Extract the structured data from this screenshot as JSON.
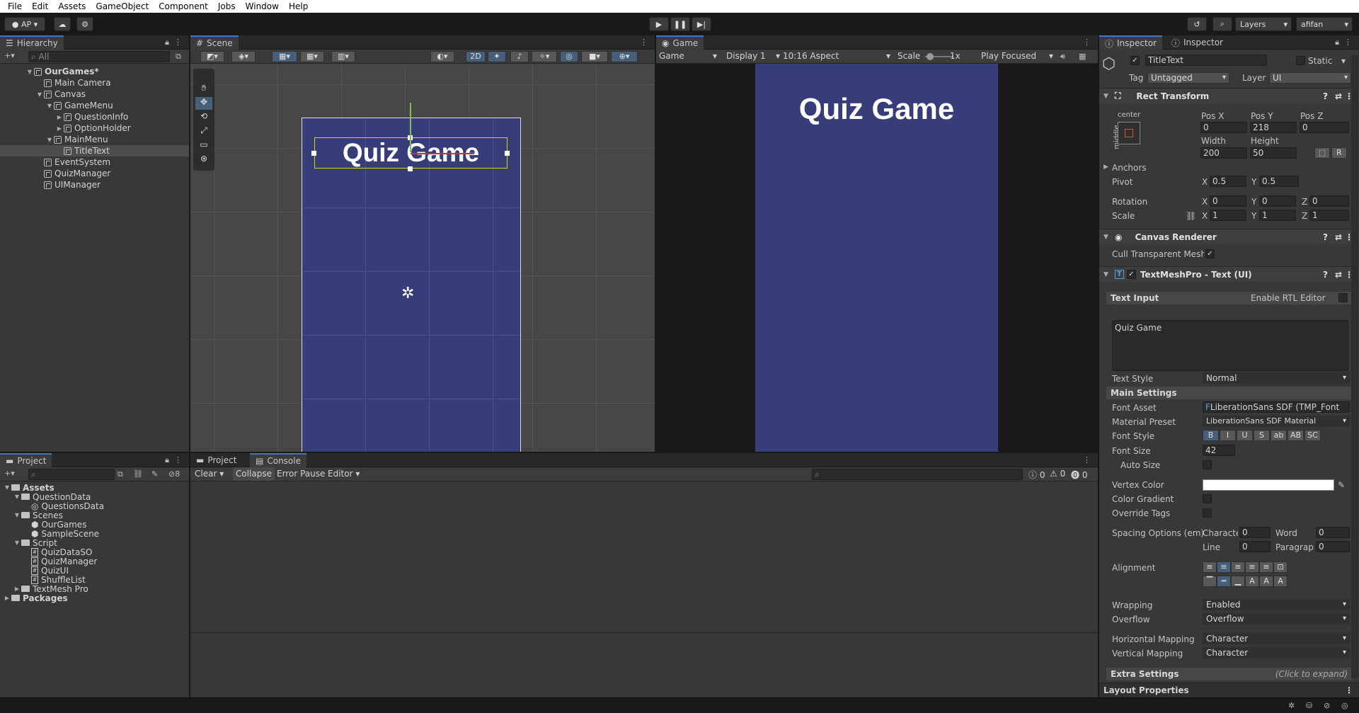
{
  "menubar": [
    "File",
    "Edit",
    "Assets",
    "GameObject",
    "Component",
    "Jobs",
    "Window",
    "Help"
  ],
  "toolbar": {
    "account": "AP",
    "layers": "Layers",
    "user": "afifan"
  },
  "hierarchy": {
    "tab": "Hierarchy",
    "search_placeholder": "All",
    "rows": [
      {
        "label": "OurGames*",
        "depth": 0,
        "icon": "scene-icon",
        "arrow": "▼"
      },
      {
        "label": "Main Camera",
        "depth": 1,
        "icon": "cube-icon",
        "arrow": ""
      },
      {
        "label": "Canvas",
        "depth": 1,
        "icon": "cube-icon",
        "arrow": "▼"
      },
      {
        "label": "GameMenu",
        "depth": 2,
        "icon": "cube-icon",
        "arrow": "▼"
      },
      {
        "label": "QuestionInfo",
        "depth": 3,
        "icon": "cube-icon",
        "arrow": "▶"
      },
      {
        "label": "OptionHolder",
        "depth": 3,
        "icon": "cube-icon",
        "arrow": "▶"
      },
      {
        "label": "MainMenu",
        "depth": 2,
        "icon": "cube-icon",
        "arrow": "▼"
      },
      {
        "label": "TitleText",
        "depth": 3,
        "icon": "cube-icon",
        "arrow": "",
        "selected": true
      },
      {
        "label": "EventSystem",
        "depth": 1,
        "icon": "cube-icon",
        "arrow": ""
      },
      {
        "label": "QuizManager",
        "depth": 1,
        "icon": "cube-icon",
        "arrow": ""
      },
      {
        "label": "UIManager",
        "depth": 1,
        "icon": "cube-icon",
        "arrow": ""
      }
    ]
  },
  "scene": {
    "tab": "Scene",
    "mode2d": "2D",
    "title_text": "Quiz Game"
  },
  "game": {
    "tab": "Game",
    "display_mode": "Game",
    "display": "Display 1",
    "aspect": "10:16 Aspect",
    "scale_label": "Scale",
    "scale_value": "1x",
    "play_mode": "Play Focused",
    "title_text": "Quiz Game"
  },
  "project": {
    "tab": "Project",
    "hidden_count": "8",
    "rows": [
      {
        "label": "Assets",
        "depth": 0,
        "type": "folder",
        "arrow": "▼",
        "bold": true
      },
      {
        "label": "QuestionData",
        "depth": 1,
        "type": "folder",
        "arrow": "▼"
      },
      {
        "label": "QuestionsData",
        "depth": 2,
        "type": "asset",
        "arrow": ""
      },
      {
        "label": "Scenes",
        "depth": 1,
        "type": "folder",
        "arrow": "▼"
      },
      {
        "label": "OurGames",
        "depth": 2,
        "type": "scene",
        "arrow": ""
      },
      {
        "label": "SampleScene",
        "depth": 2,
        "type": "scene",
        "arrow": ""
      },
      {
        "label": "Script",
        "depth": 1,
        "type": "folder",
        "arrow": "▼"
      },
      {
        "label": "QuizDataSO",
        "depth": 2,
        "type": "script",
        "arrow": ""
      },
      {
        "label": "QuizManager",
        "depth": 2,
        "type": "script",
        "arrow": ""
      },
      {
        "label": "QuizUI",
        "depth": 2,
        "type": "script",
        "arrow": ""
      },
      {
        "label": "ShuffleList",
        "depth": 2,
        "type": "script",
        "arrow": ""
      },
      {
        "label": "TextMesh Pro",
        "depth": 1,
        "type": "folder",
        "arrow": "▶"
      },
      {
        "label": "Packages",
        "depth": 0,
        "type": "folder",
        "arrow": "▶",
        "bold": true
      }
    ]
  },
  "console": {
    "tab_project": "Project",
    "tab_console": "Console",
    "clear": "Clear",
    "collapse": "Collapse",
    "error_pause": "Error Pause",
    "editor": "Editor",
    "count_log": "0",
    "count_warn": "0",
    "count_err": "0"
  },
  "inspector": {
    "tab1": "Inspector",
    "tab2": "Inspector",
    "object_name": "TitleText",
    "static_label": "Static",
    "tag_label": "Tag",
    "tag_value": "Untagged",
    "layer_label": "Layer",
    "layer_value": "UI",
    "rect": {
      "title": "Rect Transform",
      "anchor_h": "center",
      "anchor_v": "middle",
      "posx_label": "Pos X",
      "posy_label": "Pos Y",
      "posz_label": "Pos Z",
      "posx": "0",
      "posy": "218",
      "posz": "0",
      "width_label": "Width",
      "height_label": "Height",
      "width": "200",
      "height": "50",
      "anchors": "Anchors",
      "pivot": "Pivot",
      "pivot_x": "0.5",
      "pivot_y": "0.5",
      "rotation": "Rotation",
      "rot_x": "0",
      "rot_y": "0",
      "rot_z": "0",
      "scale": "Scale",
      "scale_x": "1",
      "scale_y": "1",
      "scale_z": "1",
      "r_button": "R"
    },
    "canvas_renderer": {
      "title": "Canvas Renderer",
      "cull_label": "Cull Transparent Mesh"
    },
    "tmp": {
      "title": "TextMeshPro - Text (UI)",
      "text_input": "Text Input",
      "rtl": "Enable RTL Editor",
      "text": "Quiz Game",
      "text_style_label": "Text Style",
      "text_style": "Normal",
      "main_settings": "Main Settings",
      "font_asset_label": "Font Asset",
      "font_asset": "LiberationSans SDF (TMP_Font",
      "material_label": "Material Preset",
      "material": "LiberationSans SDF Material",
      "font_style_label": "Font Style",
      "font_styles": [
        "B",
        "I",
        "U",
        "S",
        "ab",
        "AB",
        "SC"
      ],
      "font_size_label": "Font Size",
      "font_size": "42",
      "auto_size": "Auto Size",
      "vertex_color": "Vertex Color",
      "color_gradient": "Color Gradient",
      "override_tags": "Override Tags",
      "spacing_label": "Spacing Options (em)",
      "char_label": "Character",
      "char_val": "0",
      "word_label": "Word",
      "word_val": "0",
      "line_label": "Line",
      "line_val": "0",
      "para_label": "Paragraph",
      "para_val": "0",
      "alignment": "Alignment",
      "wrapping_label": "Wrapping",
      "wrapping": "Enabled",
      "overflow_label": "Overflow",
      "overflow": "Overflow",
      "hmap_label": "Horizontal Mapping",
      "hmap": "Character",
      "vmap_label": "Vertical Mapping",
      "vmap": "Character",
      "extra": "Extra Settings",
      "extra_hint": "(Click to expand)"
    },
    "layout_properties": "Layout Properties"
  },
  "colors": {
    "canvas_blue": "#363d79",
    "accent": "#3a79bb"
  }
}
